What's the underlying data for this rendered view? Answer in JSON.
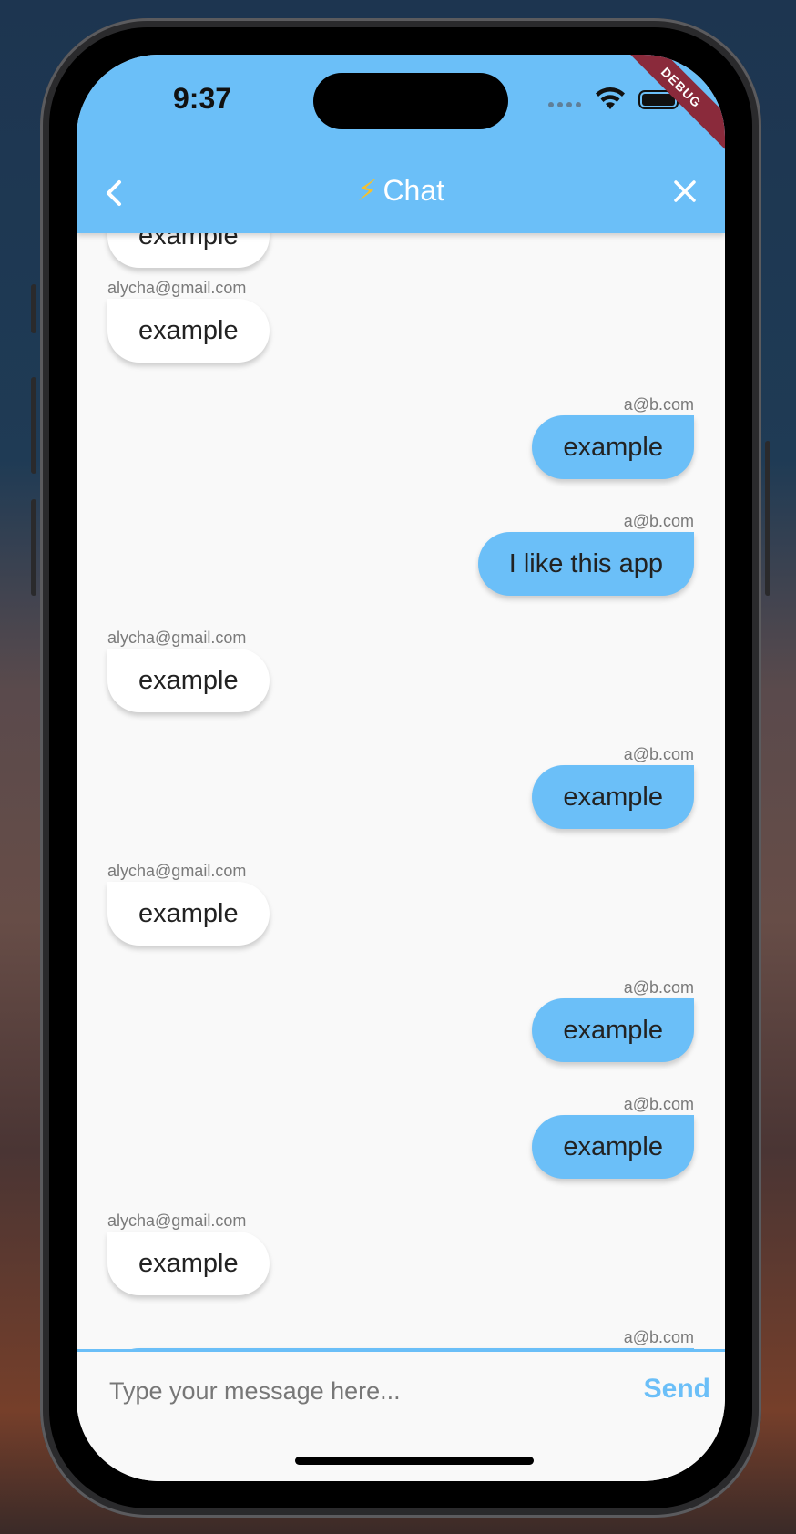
{
  "status_bar": {
    "time": "9:37",
    "debug_banner": "DEBUG"
  },
  "app_bar": {
    "title": "Chat",
    "title_icon": "lightning-bolt-icon"
  },
  "messages": [
    {
      "side": "left",
      "sender": "",
      "text": "example",
      "partial": true
    },
    {
      "side": "left",
      "sender": "alycha@gmail.com",
      "text": "example"
    },
    {
      "side": "right",
      "sender": "a@b.com",
      "text": "example"
    },
    {
      "side": "right",
      "sender": "a@b.com",
      "text": "I like this app"
    },
    {
      "side": "left",
      "sender": "alycha@gmail.com",
      "text": "example"
    },
    {
      "side": "right",
      "sender": "a@b.com",
      "text": "example"
    },
    {
      "side": "left",
      "sender": "alycha@gmail.com",
      "text": "example"
    },
    {
      "side": "right",
      "sender": "a@b.com",
      "text": "example"
    },
    {
      "side": "right",
      "sender": "a@b.com",
      "text": "example"
    },
    {
      "side": "left",
      "sender": "alycha@gmail.com",
      "text": "example"
    },
    {
      "side": "right",
      "sender": "a@b.com",
      "text": "",
      "partial": true
    }
  ],
  "composer": {
    "placeholder": "Type your message here...",
    "send_label": "Send"
  },
  "colors": {
    "accent": "#6bbff8",
    "bubble_other": "#ffffff",
    "background": "#f9f9f9"
  }
}
